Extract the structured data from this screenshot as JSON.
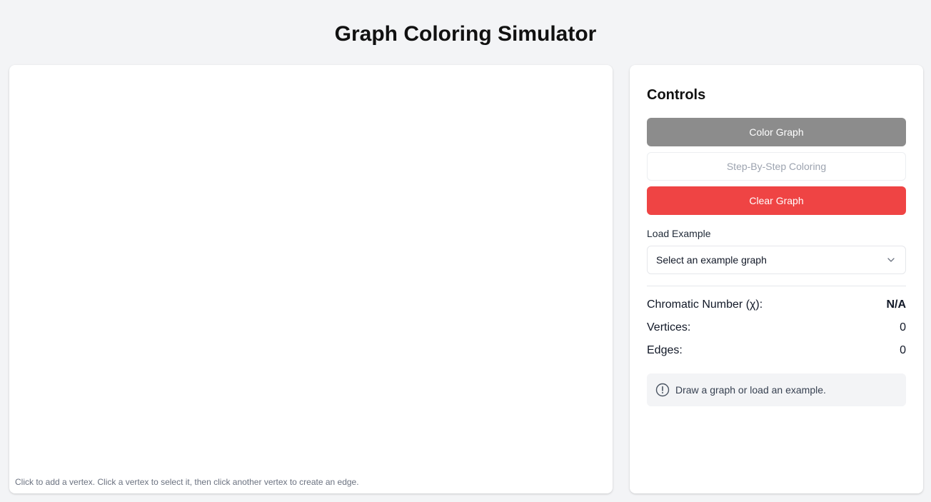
{
  "header": {
    "title": "Graph Coloring Simulator"
  },
  "canvas": {
    "hint": "Click to add a vertex. Click a vertex to select it, then click another vertex to create an edge."
  },
  "controls": {
    "title": "Controls",
    "color_graph_label": "Color Graph",
    "step_by_step_label": "Step-By-Step Coloring",
    "clear_graph_label": "Clear Graph",
    "load_example_label": "Load Example",
    "example_select_value": "Select an example graph",
    "stats": {
      "chromatic_label": "Chromatic Number (χ):",
      "chromatic_value": "N/A",
      "vertices_label": "Vertices:",
      "vertices_value": "0",
      "edges_label": "Edges:",
      "edges_value": "0"
    },
    "info_message": "Draw a graph or load an example.",
    "icons": {
      "info": "info-circle-icon",
      "dropdown": "chevron-down-icon"
    }
  },
  "colors": {
    "color_button": "#8c8c8c",
    "clear_button": "#ef4444",
    "background": "#f3f4f6"
  }
}
